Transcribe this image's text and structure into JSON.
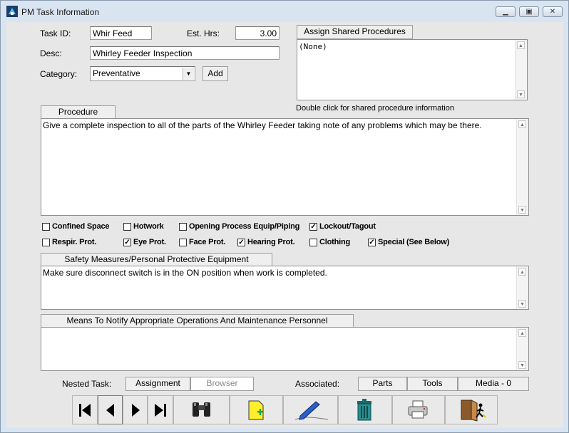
{
  "window": {
    "title": "PM Task Information"
  },
  "form": {
    "task_id_label": "Task ID:",
    "task_id_value": "Whir Feed",
    "est_hrs_label": "Est. Hrs:",
    "est_hrs_value": "3.00",
    "desc_label": "Desc:",
    "desc_value": "Whirley Feeder Inspection",
    "category_label": "Category:",
    "category_value": "Preventative",
    "add_label": "Add"
  },
  "shared": {
    "button_label": "Assign Shared Procedures",
    "list_item": "(None)",
    "hint": "Double click for shared procedure information"
  },
  "procedure": {
    "header": "Procedure",
    "text": "Give a complete inspection to all of the parts of the Whirley Feeder taking note of any problems which may be there."
  },
  "checkboxes": [
    {
      "label": "Confined Space",
      "checked": false
    },
    {
      "label": "Hotwork",
      "checked": false
    },
    {
      "label": "Opening Process Equip/Piping",
      "checked": false
    },
    {
      "label": "Lockout/Tagout",
      "checked": true
    },
    {
      "label": "Respir. Prot.",
      "checked": false
    },
    {
      "label": "Eye Prot.",
      "checked": true
    },
    {
      "label": "Face Prot.",
      "checked": false
    },
    {
      "label": "Hearing Prot.",
      "checked": true
    },
    {
      "label": "Clothing",
      "checked": false
    },
    {
      "label": "Special (See Below)",
      "checked": true
    }
  ],
  "safety": {
    "header": "Safety Measures/Personal Protective Equipment",
    "text": "Make sure disconnect switch is in the ON position when work is completed."
  },
  "notify": {
    "header": "Means To Notify Appropriate Operations And Maintenance Personnel",
    "text": ""
  },
  "bottom": {
    "nested_label": "Nested Task:",
    "assignment": "Assignment",
    "browser": "Browser",
    "associated_label": "Associated:",
    "parts": "Parts",
    "tools": "Tools",
    "media": "Media - 0"
  },
  "check_mark": "✓",
  "icons": [
    "first-record-icon",
    "prev-record-icon",
    "next-record-icon",
    "last-record-icon",
    "binoculars-icon",
    "new-document-icon",
    "signature-pen-icon",
    "trash-icon",
    "printer-icon",
    "exit-door-icon"
  ]
}
